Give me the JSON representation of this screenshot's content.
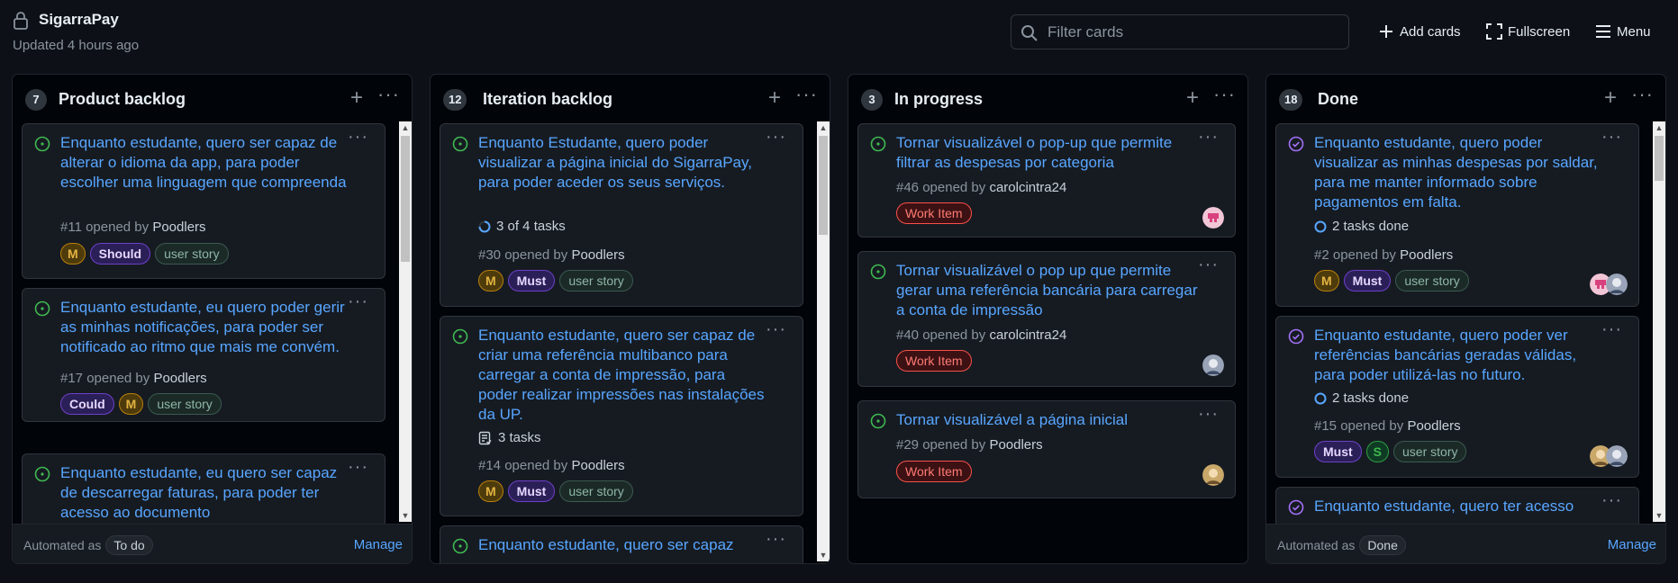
{
  "project": {
    "title": "SigarraPay",
    "updated": "Updated 4 hours ago"
  },
  "toolbar": {
    "filter_placeholder": "Filter cards",
    "add_cards": "Add cards",
    "fullscreen": "Fullscreen",
    "menu": "Menu"
  },
  "columns": [
    {
      "name": "Product backlog",
      "count": "7",
      "automation": {
        "label": "Automated as",
        "value": "To do",
        "manage": "Manage"
      },
      "cards": [
        {
          "title": "Enquanto estudante, quero ser capaz de alterar o idioma da app, para poder escolher uma linguagem que compreenda",
          "number": "#11 opened by",
          "author": "Poodlers",
          "labels": [
            "M",
            "Should",
            "user story"
          ]
        },
        {
          "title": "Enquanto estudante, eu quero poder gerir as minhas notificações, para poder ser notificado ao ritmo que mais me convém.",
          "number": "#17 opened by",
          "author": "Poodlers",
          "labels": [
            "Could",
            "M",
            "user story"
          ]
        },
        {
          "title": "Enquanto estudante, eu quero ser capaz de descarregar faturas, para poder ter acesso ao documento"
        }
      ]
    },
    {
      "name": "Iteration backlog",
      "count": "12",
      "cards": [
        {
          "title": "Enquanto Estudante, quero poder visualizar a página inicial do SigarraPay, para poder aceder os seus serviços.",
          "tasks": "3 of 4 tasks",
          "number": "#30 opened by",
          "author": "Poodlers",
          "labels": [
            "M",
            "Must",
            "user story"
          ]
        },
        {
          "title": "Enquanto estudante, quero ser capaz de criar uma referência multibanco para carregar a conta de impressão, para poder realizar impressões nas instalações da UP.",
          "tasks": "3 tasks",
          "number": "#14 opened by",
          "author": "Poodlers",
          "labels": [
            "M",
            "Must",
            "user story"
          ]
        },
        {
          "title": "Enquanto estudante, quero ser capaz"
        }
      ]
    },
    {
      "name": "In progress",
      "count": "3",
      "cards": [
        {
          "title": "Tornar visualizável o pop-up que permite filtrar as despesas por categoria",
          "number": "#46 opened by",
          "author": "carolcintra24",
          "labels": [
            "Work Item"
          ]
        },
        {
          "title": "Tornar visualizável o pop up que permite gerar uma referência bancária para carregar a conta de impressão",
          "number": "#40 opened by",
          "author": "carolcintra24",
          "labels": [
            "Work Item"
          ]
        },
        {
          "title": "Tornar visualizável a página inicial",
          "number": "#29 opened by",
          "author": "Poodlers",
          "labels": [
            "Work Item"
          ]
        }
      ]
    },
    {
      "name": "Done",
      "count": "18",
      "automation": {
        "label": "Automated as",
        "value": "Done",
        "manage": "Manage"
      },
      "cards": [
        {
          "title": "Enquanto estudante, quero poder visualizar as minhas despesas por saldar, para me manter informado sobre pagamentos em falta.",
          "tasks": "2 tasks done",
          "number": "#2 opened by",
          "author": "Poodlers",
          "labels": [
            "M",
            "Must",
            "user story"
          ]
        },
        {
          "title": "Enquanto estudante, quero poder ver referências bancárias geradas válidas, para poder utilizá-las no futuro.",
          "tasks": "2 tasks done",
          "number": "#15 opened by",
          "author": "Poodlers",
          "labels": [
            "Must",
            "S",
            "user story"
          ]
        },
        {
          "title": "Enquanto estudante, quero ter acesso"
        }
      ]
    }
  ],
  "colors": {
    "open": "#3fb950",
    "closed": "#a371f7",
    "link": "#58a6ff"
  }
}
